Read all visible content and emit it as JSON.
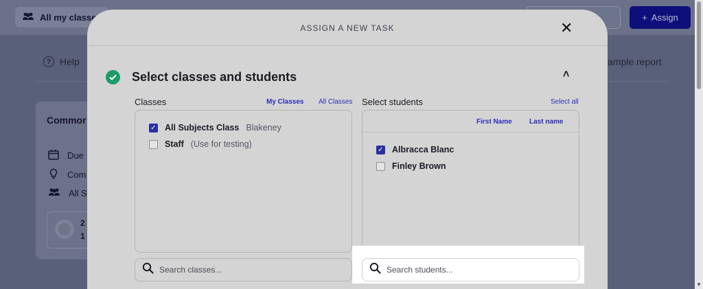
{
  "background": {
    "classes_selector": "All my classes",
    "assign_label": "Assign",
    "help_label": "Help",
    "sample_report_label": "ample report",
    "card_title": "Commor",
    "card_rows": [
      "Due",
      "Com",
      "All Su"
    ],
    "mini_numbers": [
      "2",
      "1"
    ]
  },
  "modal": {
    "title": "ASSIGN A NEW TASK",
    "close_glyph": "✕",
    "section_title": "Select classes and students",
    "collapse_glyph": "˄",
    "classes": {
      "label": "Classes",
      "tab_my": "My Classes",
      "tab_all": "All Classes",
      "items": [
        {
          "name": "All Subjects Class",
          "sub": "Blakeney",
          "checked": true
        },
        {
          "name": "Staff",
          "sub": "(Use for testing)",
          "checked": false
        }
      ],
      "search_placeholder": "Search classes..."
    },
    "students": {
      "label": "Select students",
      "select_all": "Select all",
      "sort_first": "First Name",
      "sort_last": "Last name",
      "items": [
        {
          "name": "Albracca Blanc",
          "checked": true
        },
        {
          "name": "Finley Brown",
          "checked": false
        }
      ],
      "search_placeholder": "Search students..."
    }
  },
  "colors": {
    "accent": "#2a2fb8",
    "success": "#1e9b6a",
    "assign_button": "#0e0f7a"
  }
}
